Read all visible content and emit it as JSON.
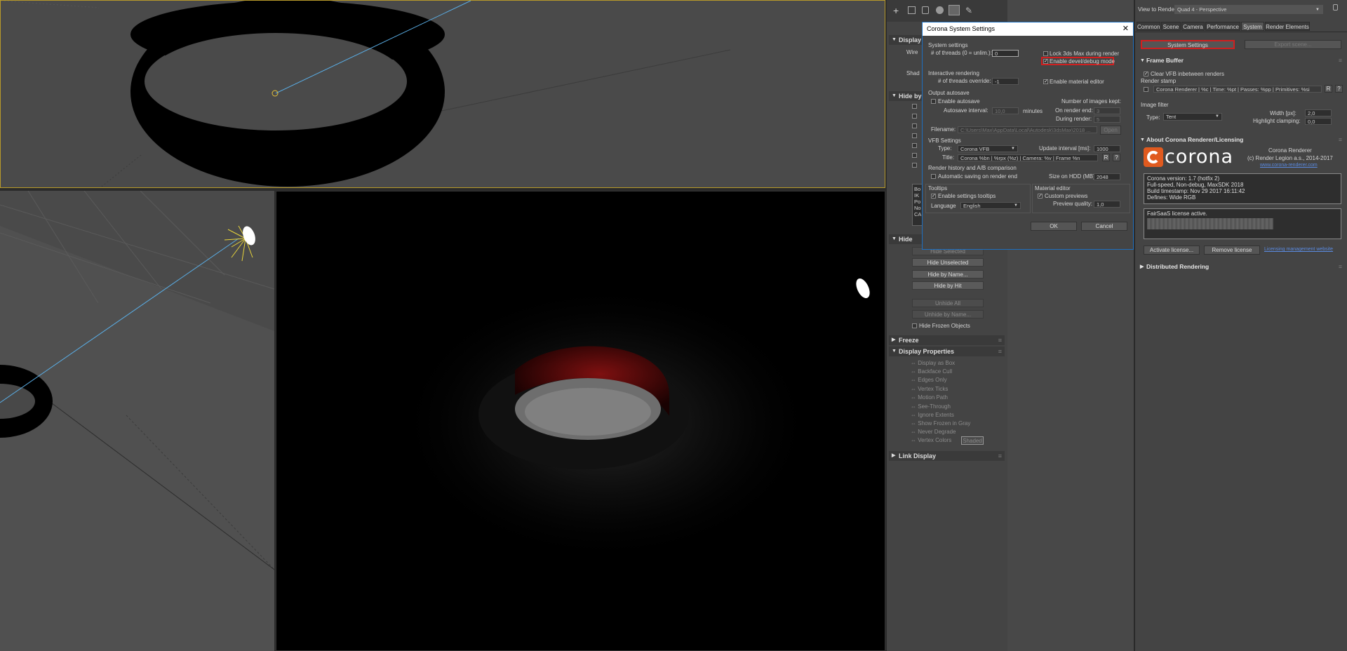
{
  "viewport_top": {},
  "viewport_persp": {},
  "command_panel": {
    "display_head": "Display",
    "display_labels": [
      "Wire",
      "Shad"
    ],
    "hide_by_head": "Hide by",
    "hide_by_list": [
      "Bo",
      "IK",
      "Po",
      "No",
      "CA"
    ],
    "hide_head": "Hide",
    "hide_buttons": [
      "Hide Selected",
      "Hide Unselected",
      "Hide by Name...",
      "Hide by Hit",
      "Unhide All",
      "Unhide by Name..."
    ],
    "hide_frozen": "Hide Frozen Objects",
    "freeze_head": "Freeze",
    "display_props_head": "Display Properties",
    "display_props": [
      "Display as Box",
      "Backface Cull",
      "Edges Only",
      "Vertex Ticks",
      "Motion Path",
      "See-Through",
      "Ignore Extents",
      "Show Frozen in Gray",
      "Never Degrade",
      "Vertex Colors"
    ],
    "shaded_btn": "Shaded",
    "link_display_head": "Link Display"
  },
  "dialog": {
    "title": "Corona System Settings",
    "system_settings": "System settings",
    "threads_label": "# of threads (0 = unlim.):",
    "threads_value": "0",
    "lock_3ds": "Lock 3ds Max during render",
    "devel_mode": "Enable devel/debug mode",
    "interactive": "Interactive rendering",
    "threads_override": "# of threads override:",
    "threads_override_value": "-1",
    "enable_mat_editor": "Enable material editor",
    "output_autosave": "Output autosave",
    "enable_autosave": "Enable autosave",
    "num_images": "Number of images kept:",
    "autosave_interval": "Autosave interval:",
    "autosave_value": "10,0",
    "minutes": "minutes",
    "on_render_end": "On render end:",
    "on_render_end_value": "3",
    "during_render": "During render:",
    "during_render_value": "5",
    "filename": "Filename:",
    "filename_value": "C:\\Users\\Max\\AppData\\Local\\Autodesk\\3dsMax\\2018 ...",
    "open": "Open",
    "vfb_settings": "VFB Settings",
    "type": "Type:",
    "type_value": "Corona VFB",
    "update_interval": "Update interval [ms]:",
    "update_value": "1000",
    "title_label": "Title:",
    "title_value": "Corona %bn | %rpx (%z) | Camera: %v | Frame %n",
    "r_btn": "R",
    "q_btn": "?",
    "history": "Render history and A/B comparison",
    "auto_save": "Automatic saving on render end",
    "size_hdd": "Size on HDD (MB):",
    "size_value": "2048",
    "tooltips": "Tooltips",
    "enable_tooltips": "Enable settings tooltips",
    "language": "Language",
    "language_value": "English",
    "material_editor": "Material editor",
    "custom_previews": "Custom previews",
    "preview_quality": "Preview quality:",
    "preview_value": "1,0",
    "ok": "OK",
    "cancel": "Cancel"
  },
  "render_setup": {
    "view_label": "View to Render:",
    "view_value": "Quad 4 - Perspective",
    "tabs": [
      "Common",
      "Scene",
      "Camera",
      "Performance",
      "System",
      "Render Elements"
    ],
    "system_settings_btn": "System Settings",
    "export_scene_btn": "Export scene...",
    "frame_buffer_head": "Frame Buffer",
    "clear_vfb": "Clear VFB inbetween renders",
    "render_stamp": "Render stamp",
    "stamp_value": "Corona Renderer | %c | Time: %pt | Passes: %pp | Primitives: %si",
    "image_filter": "Image filter",
    "filter_type": "Type:",
    "filter_value": "Tent",
    "width_px": "Width [px]:",
    "width_value": "2,0",
    "highlight": "Highlight clamping:",
    "highlight_value": "0,0",
    "about_head": "About Corona Renderer/Licensing",
    "logo_text": "corona",
    "product": "Corona Renderer",
    "copyright": "(c) Render Legion a.s., 2014-2017",
    "website_link": "www.corona-renderer.com",
    "info_lines": [
      "Corona version: 1.7 (hotfix 2)",
      "Full-speed, Non-debug, MaxSDK 2018",
      "Build timestamp: Nov 29 2017 16:11:42",
      "Defines: Wide RGB"
    ],
    "license_status": "FairSaaS license active.",
    "activate_btn": "Activate license...",
    "remove_btn": "Remove license",
    "license_link": "Licensing management website",
    "distributed_head": "Distributed Rendering"
  }
}
